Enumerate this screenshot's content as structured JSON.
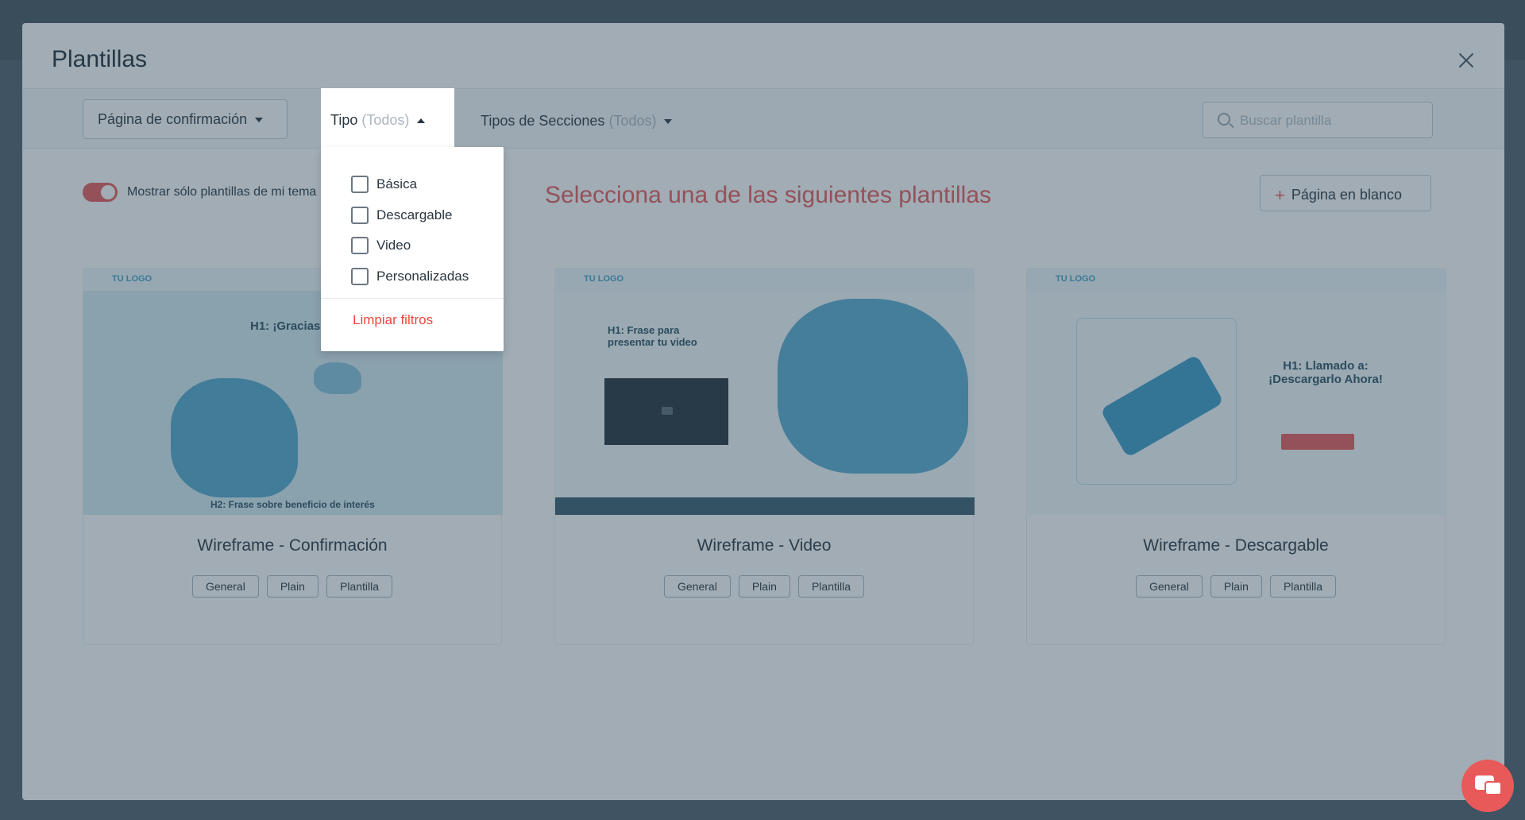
{
  "modal": {
    "title": "Plantillas"
  },
  "filters": {
    "page_type_label": "Página de confirmación",
    "tipo_label": "Tipo",
    "tipo_value": "(Todos)",
    "secciones_label": "Tipos de Secciones",
    "secciones_value": "(Todos)",
    "search_placeholder": "Buscar plantilla"
  },
  "toggle": {
    "label": "Mostrar sólo plantillas de mi tema",
    "on": true
  },
  "main_title": "Selecciona una de las siguientes plantillas",
  "blank_button": "Página en blanco",
  "dropdown": {
    "options": [
      "Básica",
      "Descargable",
      "Video",
      "Personalizadas"
    ],
    "clear_label": "Limpiar filtros"
  },
  "cards": [
    {
      "name": "Wireframe - Confirmación",
      "logo": "TU LOGO",
      "h1": "H1: ¡Gracias",
      "h2": "H2: Frase sobre beneficio de interés",
      "tags": [
        "General",
        "Plain",
        "Plantilla"
      ]
    },
    {
      "name": "Wireframe - Video",
      "logo": "TU LOGO",
      "h1": "H1: Frase para presentar tu video",
      "tags": [
        "General",
        "Plain",
        "Plantilla"
      ]
    },
    {
      "name": "Wireframe - Descargable",
      "logo": "TU LOGO",
      "h1": "H1: Llamado a: ¡Descargarlo Ahora!",
      "tags": [
        "General",
        "Plain",
        "Plantilla"
      ]
    }
  ],
  "colors": {
    "accent": "#e85a5a",
    "overlay": "#2e4658"
  },
  "icons": {
    "close": "close-icon",
    "search": "search-icon",
    "chat": "chat-icon"
  }
}
